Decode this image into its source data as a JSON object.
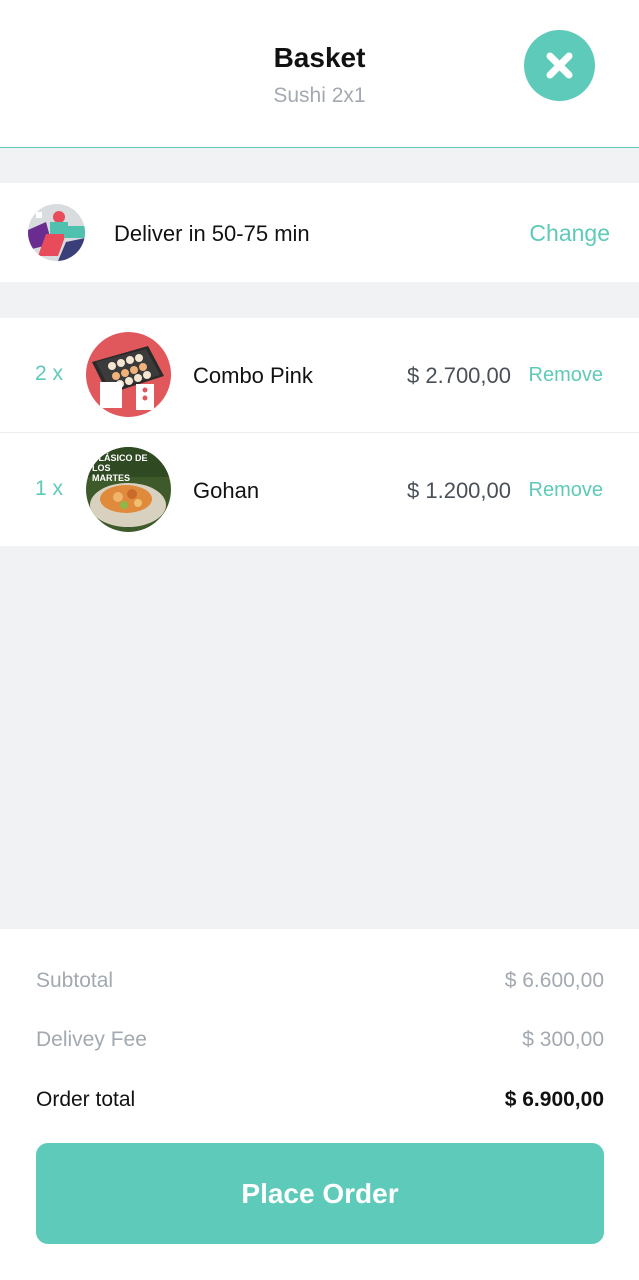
{
  "header": {
    "title": "Basket",
    "subtitle": "Sushi 2x1",
    "close_icon": "close-icon"
  },
  "delivery": {
    "text": "Deliver in 50-75 min",
    "change_label": "Change"
  },
  "items": [
    {
      "qty": "2 x",
      "name": "Combo Pink",
      "price": "$ 2.700,00",
      "remove_label": "Remove"
    },
    {
      "qty": "1 x",
      "name": "Gohan",
      "price": "$ 1.200,00",
      "remove_label": "Remove",
      "image_text": "CLÁSICO DE LOS MARTES"
    }
  ],
  "summary": {
    "subtotal_label": "Subtotal",
    "subtotal_value": "$ 6.600,00",
    "fee_label": "Delivey Fee",
    "fee_value": "$ 300,00",
    "total_label": "Order total",
    "total_value": "$ 6.900,00"
  },
  "place_order_label": "Place Order",
  "colors": {
    "accent": "#5ecab9",
    "background": "#f1f2f4",
    "muted_text": "#a3a9b0"
  }
}
